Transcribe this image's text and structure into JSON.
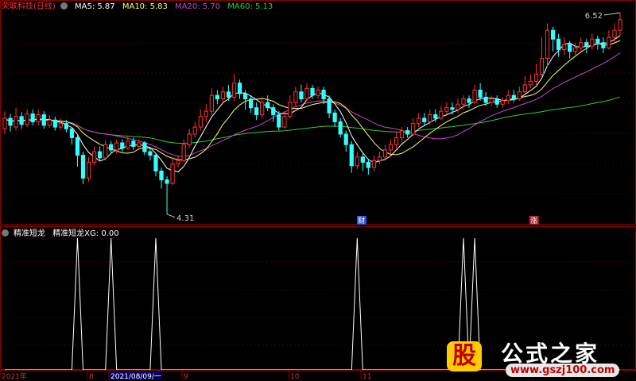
{
  "main_legend": {
    "title": "荣联科技(日线)",
    "ma5": "MA5: 5.87",
    "ma10": "MA10: 5.83",
    "ma20": "MA20: 5.70",
    "ma60": "MA60: 5.13"
  },
  "sub_legend": {
    "title": "精准短龙",
    "value": "精准短龙XG: 0.00"
  },
  "annotations": {
    "high_label": "6.52",
    "low_label": "4.31",
    "marker_cai": "财",
    "marker_zhang": "涨"
  },
  "date_axis": {
    "labels": [
      "2021年",
      "8",
      "2021/08/09/一",
      "9",
      "10",
      "11"
    ]
  },
  "watermark": {
    "badge_char": "股",
    "title": "公式之家",
    "url": "www.gszj100.com"
  },
  "colors": {
    "up": "#ff3333",
    "down": "#33ffff",
    "ma5": "#ffffff",
    "ma10": "#ffff66",
    "ma20": "#cc44cc",
    "ma60": "#33cc33",
    "signal": "#ffffff",
    "grid": "#8b0000"
  },
  "chart_data": [
    {
      "type": "candlestick",
      "title": "荣联科技(日线)",
      "series_note": "price_range_shown_between_4.31_and_6.52",
      "ylim": [
        4.2,
        6.6
      ],
      "y_ticks": [],
      "marked_high": 6.52,
      "marked_low": 4.31,
      "candles": [
        [
          5.28,
          5.4,
          5.48,
          5.22
        ],
        [
          5.4,
          5.32,
          5.45,
          5.25
        ],
        [
          5.3,
          5.42,
          5.52,
          5.26
        ],
        [
          5.42,
          5.33,
          5.47,
          5.28
        ],
        [
          5.33,
          5.45,
          5.5,
          5.3
        ],
        [
          5.45,
          5.36,
          5.5,
          5.32
        ],
        [
          5.36,
          5.44,
          5.5,
          5.32
        ],
        [
          5.44,
          5.32,
          5.48,
          5.28
        ],
        [
          5.32,
          5.38,
          5.44,
          5.29
        ],
        [
          5.38,
          5.3,
          5.42,
          5.26
        ],
        [
          5.3,
          5.34,
          5.4,
          5.27
        ],
        [
          5.34,
          5.28,
          5.38,
          5.24
        ],
        [
          5.28,
          5.18,
          5.3,
          5.1
        ],
        [
          5.18,
          4.98,
          5.22,
          4.85
        ],
        [
          4.98,
          4.72,
          5.02,
          4.65
        ],
        [
          4.72,
          4.9,
          4.96,
          4.68
        ],
        [
          4.9,
          5.02,
          5.08,
          4.86
        ],
        [
          5.02,
          4.95,
          5.08,
          4.92
        ],
        [
          4.95,
          5.1,
          5.15,
          4.92
        ],
        [
          5.1,
          5.04,
          5.14,
          5.0
        ],
        [
          5.04,
          5.12,
          5.16,
          5.0
        ],
        [
          5.12,
          5.06,
          5.16,
          5.02
        ],
        [
          5.06,
          5.14,
          5.2,
          5.04
        ],
        [
          5.14,
          5.08,
          5.18,
          5.04
        ],
        [
          5.08,
          5.12,
          5.16,
          5.04
        ],
        [
          5.12,
          5.02,
          5.14,
          4.98
        ],
        [
          5.02,
          4.98,
          5.06,
          4.92
        ],
        [
          4.98,
          4.8,
          5.0,
          4.74
        ],
        [
          4.8,
          4.7,
          4.84,
          4.6
        ],
        [
          4.7,
          4.66,
          4.74,
          4.31
        ],
        [
          4.66,
          4.88,
          4.96,
          4.64
        ],
        [
          4.88,
          4.92,
          4.98,
          4.84
        ],
        [
          4.92,
          5.1,
          5.16,
          4.9
        ],
        [
          5.1,
          5.22,
          5.28,
          5.06
        ],
        [
          5.22,
          5.3,
          5.36,
          5.18
        ],
        [
          5.3,
          5.42,
          5.5,
          5.26
        ],
        [
          5.42,
          5.48,
          5.56,
          5.36
        ],
        [
          5.48,
          5.66,
          5.74,
          5.44
        ],
        [
          5.66,
          5.62,
          5.72,
          5.56
        ],
        [
          5.62,
          5.7,
          5.76,
          5.58
        ],
        [
          5.7,
          5.64,
          5.78,
          5.6
        ],
        [
          5.64,
          5.8,
          5.9,
          5.6
        ],
        [
          5.8,
          5.68,
          5.84,
          5.62
        ],
        [
          5.68,
          5.62,
          5.72,
          5.5
        ],
        [
          5.62,
          5.52,
          5.66,
          5.46
        ],
        [
          5.52,
          5.44,
          5.58,
          5.38
        ],
        [
          5.44,
          5.58,
          5.62,
          5.4
        ],
        [
          5.58,
          5.52,
          5.66,
          5.48
        ],
        [
          5.52,
          5.44,
          5.56,
          5.36
        ],
        [
          5.44,
          5.3,
          5.48,
          5.26
        ],
        [
          5.3,
          5.42,
          5.48,
          5.28
        ],
        [
          5.42,
          5.58,
          5.66,
          5.4
        ],
        [
          5.58,
          5.7,
          5.76,
          5.54
        ],
        [
          5.7,
          5.62,
          5.78,
          5.58
        ],
        [
          5.62,
          5.74,
          5.8,
          5.6
        ],
        [
          5.74,
          5.66,
          5.78,
          5.62
        ],
        [
          5.66,
          5.72,
          5.76,
          5.62
        ],
        [
          5.72,
          5.62,
          5.76,
          5.56
        ],
        [
          5.62,
          5.46,
          5.66,
          5.4
        ],
        [
          5.46,
          5.36,
          5.5,
          5.3
        ],
        [
          5.36,
          5.22,
          5.4,
          5.18
        ],
        [
          5.22,
          5.1,
          5.26,
          5.02
        ],
        [
          5.1,
          4.86,
          5.14,
          4.78
        ],
        [
          4.86,
          4.96,
          5.02,
          4.82
        ],
        [
          4.96,
          4.9,
          5.0,
          4.8
        ],
        [
          4.9,
          4.84,
          4.94,
          4.76
        ],
        [
          4.84,
          4.92,
          4.98,
          4.8
        ],
        [
          4.92,
          4.96,
          5.02,
          4.88
        ],
        [
          4.96,
          5.04,
          5.1,
          4.92
        ],
        [
          5.04,
          5.1,
          5.16,
          5.0
        ],
        [
          5.1,
          5.18,
          5.24,
          5.06
        ],
        [
          5.18,
          5.26,
          5.3,
          5.14
        ],
        [
          5.26,
          5.22,
          5.3,
          5.18
        ],
        [
          5.22,
          5.34,
          5.4,
          5.2
        ],
        [
          5.34,
          5.4,
          5.46,
          5.3
        ],
        [
          5.4,
          5.36,
          5.46,
          5.32
        ],
        [
          5.36,
          5.44,
          5.5,
          5.32
        ],
        [
          5.44,
          5.4,
          5.5,
          5.36
        ],
        [
          5.4,
          5.48,
          5.54,
          5.38
        ],
        [
          5.48,
          5.52,
          5.58,
          5.44
        ],
        [
          5.52,
          5.5,
          5.58,
          5.44
        ],
        [
          5.5,
          5.56,
          5.62,
          5.46
        ],
        [
          5.56,
          5.62,
          5.66,
          5.5
        ],
        [
          5.62,
          5.58,
          5.66,
          5.52
        ],
        [
          5.58,
          5.72,
          5.78,
          5.56
        ],
        [
          5.72,
          5.64,
          5.8,
          5.6
        ],
        [
          5.64,
          5.58,
          5.7,
          5.54
        ],
        [
          5.58,
          5.62,
          5.66,
          5.54
        ],
        [
          5.62,
          5.56,
          5.66,
          5.52
        ],
        [
          5.56,
          5.6,
          5.64,
          5.52
        ],
        [
          5.6,
          5.66,
          5.72,
          5.56
        ],
        [
          5.66,
          5.62,
          5.72,
          5.58
        ],
        [
          5.62,
          5.7,
          5.76,
          5.6
        ],
        [
          5.7,
          5.78,
          5.88,
          5.66
        ],
        [
          5.78,
          5.82,
          5.9,
          5.74
        ],
        [
          5.82,
          5.9,
          6.02,
          5.78
        ],
        [
          5.9,
          6.08,
          6.32,
          5.86
        ],
        [
          6.08,
          6.4,
          6.48,
          5.98
        ],
        [
          6.4,
          6.3,
          6.44,
          6.16
        ],
        [
          6.3,
          6.18,
          6.36,
          6.1
        ],
        [
          6.18,
          6.24,
          6.32,
          6.12
        ],
        [
          6.24,
          6.16,
          6.28,
          6.08
        ],
        [
          6.16,
          6.2,
          6.26,
          6.12
        ],
        [
          6.2,
          6.26,
          6.32,
          6.16
        ],
        [
          6.26,
          6.22,
          6.3,
          6.14
        ],
        [
          6.22,
          6.3,
          6.36,
          6.18
        ],
        [
          6.3,
          6.26,
          6.34,
          6.18
        ],
        [
          6.26,
          6.2,
          6.32,
          6.14
        ],
        [
          6.2,
          6.32,
          6.4,
          6.18
        ],
        [
          6.32,
          6.4,
          6.48,
          6.26
        ],
        [
          6.4,
          6.52,
          6.6,
          6.34
        ]
      ],
      "ma_note": "MA values follow legend: MA5 5.87, MA10 5.83, MA20 5.70, MA60 5.13"
    },
    {
      "type": "line",
      "title": "精准短龙",
      "series": [
        {
          "name": "精准短龙XG",
          "current_value": 0.0
        }
      ],
      "ylim": [
        0,
        1
      ],
      "signal_indices": [
        13,
        19,
        27,
        63,
        82,
        84
      ],
      "n": 111
    }
  ]
}
